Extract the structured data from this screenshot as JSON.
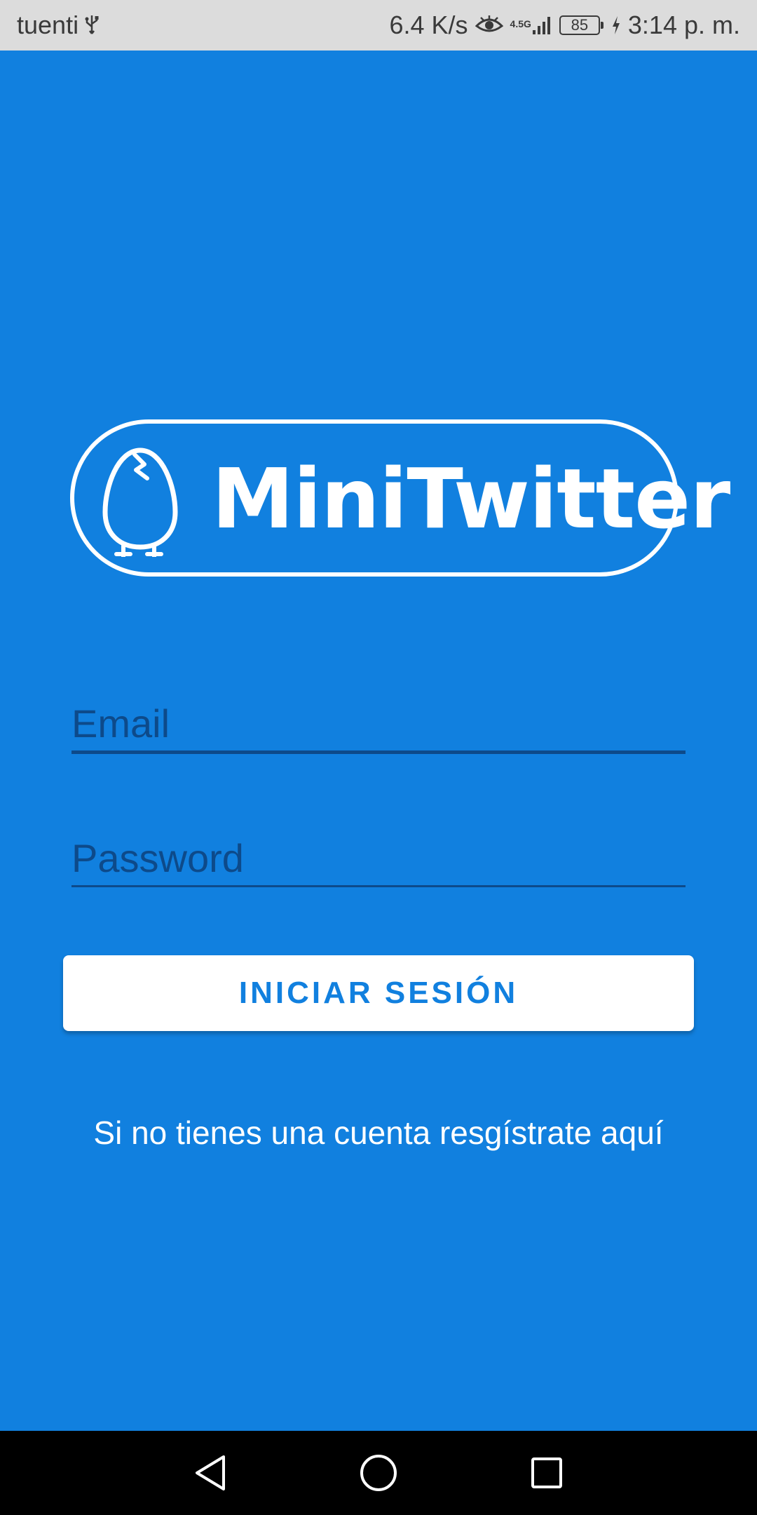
{
  "status_bar": {
    "carrier": "tuenti",
    "net_speed": "6.4 K/s",
    "network_type": "4.5G",
    "battery_level": "85",
    "time": "3:14 p. m.",
    "icons": [
      "usb-icon",
      "eye-icon",
      "signal-icon",
      "battery-icon",
      "charging-icon"
    ]
  },
  "logo": {
    "text": "MiniTwitter",
    "icon": "egg-chick-icon"
  },
  "form": {
    "email_placeholder": "Email",
    "email_value": "",
    "password_placeholder": "Password",
    "password_value": "",
    "login_label": "INICIAR SESIÓN",
    "register_text": "Si no tienes una cuenta resgístrate aquí"
  },
  "nav_bar": {
    "icons": [
      "back-icon",
      "home-icon",
      "recent-apps-icon"
    ]
  },
  "colors": {
    "background": "#1180df",
    "status_bar": "#dcdcdc",
    "input_line": "#0d4a8a",
    "button": "#ffffff",
    "button_text": "#1180df"
  }
}
